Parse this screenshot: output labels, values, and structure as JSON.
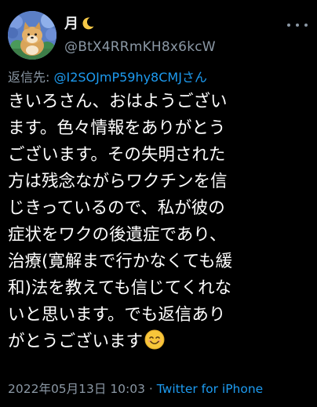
{
  "tweet": {
    "author": {
      "display_name": "月",
      "name_emoji": "crescent-moon-icon",
      "handle": "@BtX4RRmKH8x6kcW",
      "avatar": "avatar-shiba-dog-with-hydrangeas"
    },
    "more_icon": "more-options-icon",
    "reply": {
      "prefix": "返信先: ",
      "handle": "@I2SOJmP59hy8CMJさん"
    },
    "body_lines": [
      "きいろさん、おはようござい",
      "ます。色々情報をありがとう",
      "ございます。その失明された",
      "方は残念ながらワクチンを信",
      "じきっているので、私が彼の",
      "症状をワクの後遺症であり、",
      "治療(寛解まで行かなくても緩",
      "和)法を教えても信じてくれな",
      "いと思います。でも返信あり",
      "がとうございます"
    ],
    "body_end_emoji": "smiling-face-icon",
    "timestamp": "2022年05月13日 10:03",
    "separator": " · ",
    "source": "Twitter for iPhone"
  },
  "colors": {
    "background": "#000000",
    "text": "#ffffff",
    "secondary": "#8b98a5",
    "link": "#1d9bf0"
  }
}
